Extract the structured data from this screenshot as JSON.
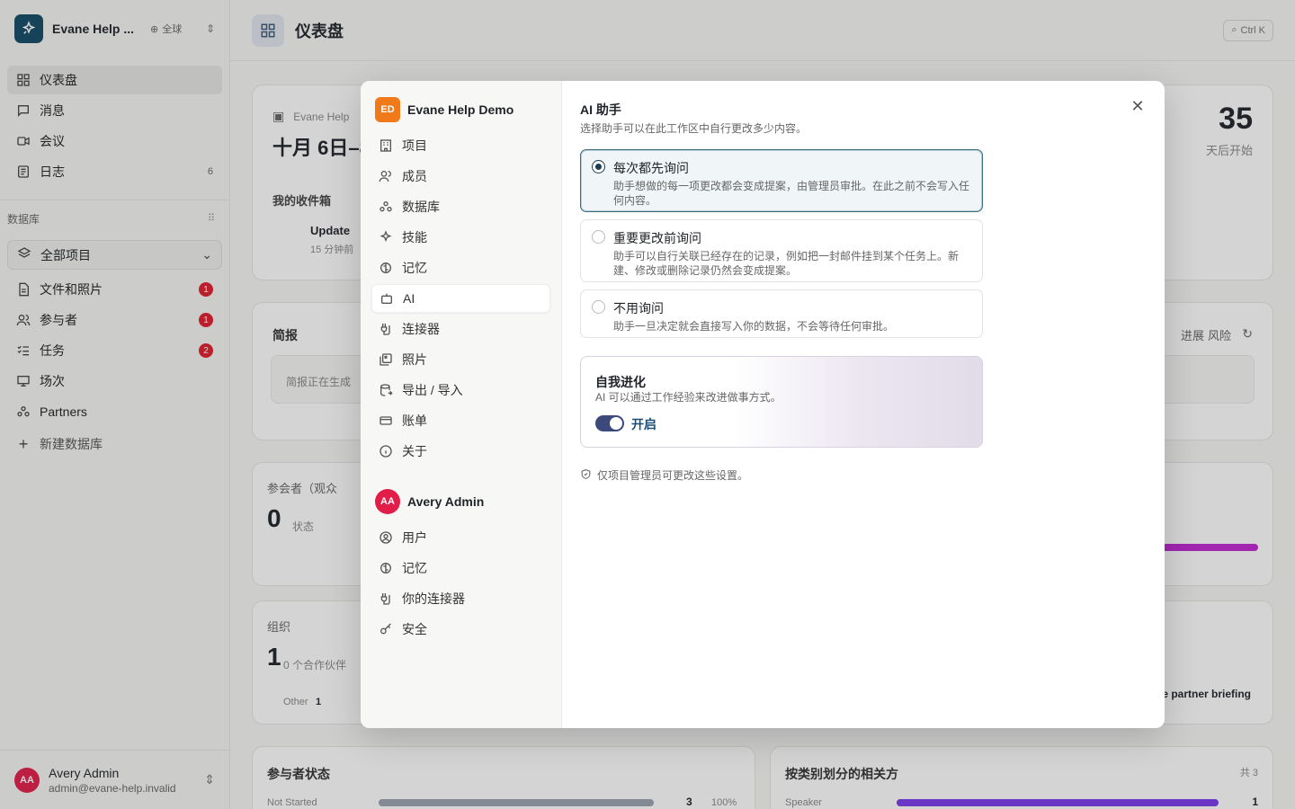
{
  "sidebar": {
    "workspace_name": "Evane Help ...",
    "workspace_scope": "全球",
    "nav": [
      {
        "label": "仪表盘",
        "icon": "dashboard-icon"
      },
      {
        "label": "消息",
        "icon": "message-icon"
      },
      {
        "label": "会议",
        "icon": "video-icon"
      },
      {
        "label": "日志",
        "icon": "log-icon",
        "count": "6"
      }
    ],
    "db_label": "数据库",
    "project_select": "全部项目",
    "db_items": [
      {
        "label": "文件和照片",
        "badge": "1"
      },
      {
        "label": "参与者",
        "badge": "1"
      },
      {
        "label": "任务",
        "badge": "2"
      },
      {
        "label": "场次"
      },
      {
        "label": "Partners"
      }
    ],
    "new_db": "新建数据库",
    "user": {
      "initials": "AA",
      "name": "Avery Admin",
      "email": "admin@evane-help.invalid"
    }
  },
  "background": {
    "page_title": "仪表盘",
    "shortcut": "Ctrl K",
    "countdown_value": "35",
    "countdown_label": "天后开始",
    "event_label": "Evane Help",
    "event_date": "十月 6日–8",
    "inbox_label": "我的收件箱",
    "inbox_item": "Update",
    "inbox_time": "15 分钟前",
    "brief_label": "简报",
    "brief_status": "简报正在生成",
    "brief_tabs": [
      "进展",
      "风险"
    ],
    "participants_label": "参会者（观众",
    "participants_value": "0",
    "participants_sub": "状态",
    "org_label": "组织",
    "org_value": "1",
    "org_sub": "0 个合作伙伴",
    "org_other": "Other",
    "org_other_count": "1",
    "partner_task": "e partner briefing",
    "status_title": "参与者状态",
    "status_row": {
      "label": "Not Started",
      "value": "3",
      "pct": "100%"
    },
    "stake_title": "按类别划分的相关方",
    "stake_total": "共 3",
    "stake_row": {
      "label": "Speaker",
      "value": "1"
    }
  },
  "modal": {
    "ws_initials": "ED",
    "ws_name": "Evane Help Demo",
    "ws_nav": [
      {
        "label": "项目"
      },
      {
        "label": "成员"
      },
      {
        "label": "数据库"
      },
      {
        "label": "技能"
      },
      {
        "label": "记忆"
      },
      {
        "label": "AI"
      },
      {
        "label": "连接器"
      },
      {
        "label": "照片"
      },
      {
        "label": "导出 / 导入"
      },
      {
        "label": "账单"
      },
      {
        "label": "关于"
      }
    ],
    "user_initials": "AA",
    "user_name": "Avery Admin",
    "user_nav": [
      {
        "label": "用户"
      },
      {
        "label": "记忆"
      },
      {
        "label": "你的连接器"
      },
      {
        "label": "安全"
      }
    ],
    "title": "AI 助手",
    "subtitle": "选择助手可以在此工作区中自行更改多少内容。",
    "options": [
      {
        "title": "每次都先询问",
        "desc": "助手想做的每一项更改都会变成提案，由管理员审批。在此之前不会写入任何内容。",
        "selected": true
      },
      {
        "title": "重要更改前询问",
        "desc": "助手可以自行关联已经存在的记录，例如把一封邮件挂到某个任务上。新建、修改或删除记录仍然会变成提案。",
        "selected": false
      },
      {
        "title": "不用询问",
        "desc": "助手一旦决定就会直接写入你的数据，不会等待任何审批。",
        "selected": false
      }
    ],
    "evolution": {
      "title": "自我进化",
      "desc": "AI 可以通过工作经验来改进做事方式。",
      "toggle_label": "开启",
      "enabled": true
    },
    "note": "仅项目管理员可更改这些设置。"
  }
}
